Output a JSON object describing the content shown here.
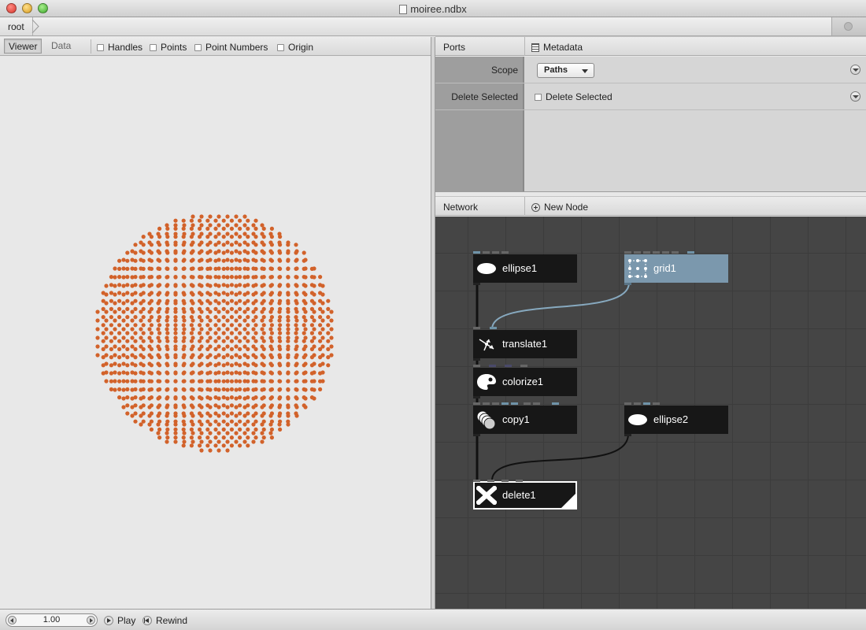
{
  "window": {
    "title": "moiree.ndbx"
  },
  "breadcrumb": {
    "root": "root"
  },
  "viewer": {
    "tabs": [
      "Viewer",
      "Data"
    ],
    "checkboxes": [
      "Handles",
      "Points",
      "Point Numbers",
      "Origin"
    ],
    "dot_color": "#d2622a"
  },
  "ports": {
    "header": "Ports",
    "metadata": "Metadata",
    "rows": [
      {
        "label": "Scope",
        "value": "Paths"
      },
      {
        "label": "Delete Selected",
        "value": "Delete Selected"
      }
    ]
  },
  "network": {
    "header": "Network",
    "new_node": "New Node",
    "nodes": {
      "ellipse1": "ellipse1",
      "grid1": "grid1",
      "translate1": "translate1",
      "colorize1": "colorize1",
      "copy1": "copy1",
      "ellipse2": "ellipse2",
      "delete1": "delete1"
    },
    "colors": {
      "grid_node": "#7b98ad",
      "node": "#171717",
      "wire_blue": "#87a9bf",
      "wire_dark": "#111111"
    }
  },
  "playback": {
    "frame": "1.00",
    "play": "Play",
    "rewind": "Rewind"
  }
}
